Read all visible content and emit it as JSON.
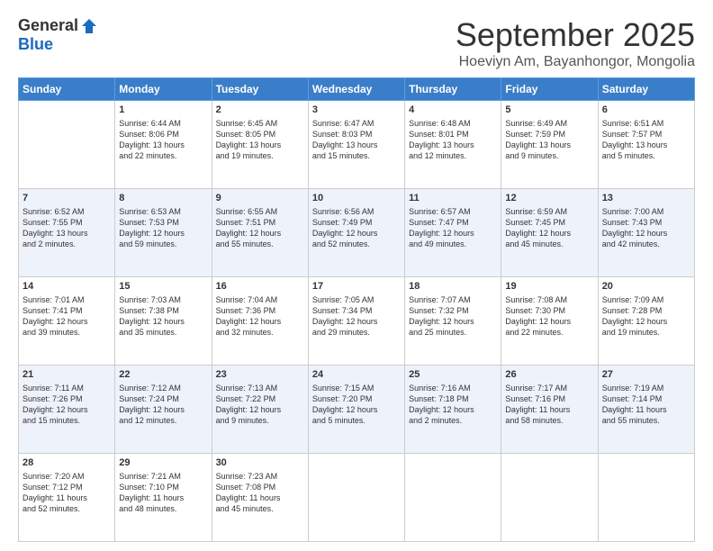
{
  "logo": {
    "general": "General",
    "blue": "Blue"
  },
  "header": {
    "month": "September 2025",
    "location": "Hoeviyn Am, Bayanhongor, Mongolia"
  },
  "days_of_week": [
    "Sunday",
    "Monday",
    "Tuesday",
    "Wednesday",
    "Thursday",
    "Friday",
    "Saturday"
  ],
  "weeks": [
    [
      {
        "day": "",
        "info": ""
      },
      {
        "day": "1",
        "info": "Sunrise: 6:44 AM\nSunset: 8:06 PM\nDaylight: 13 hours\nand 22 minutes."
      },
      {
        "day": "2",
        "info": "Sunrise: 6:45 AM\nSunset: 8:05 PM\nDaylight: 13 hours\nand 19 minutes."
      },
      {
        "day": "3",
        "info": "Sunrise: 6:47 AM\nSunset: 8:03 PM\nDaylight: 13 hours\nand 15 minutes."
      },
      {
        "day": "4",
        "info": "Sunrise: 6:48 AM\nSunset: 8:01 PM\nDaylight: 13 hours\nand 12 minutes."
      },
      {
        "day": "5",
        "info": "Sunrise: 6:49 AM\nSunset: 7:59 PM\nDaylight: 13 hours\nand 9 minutes."
      },
      {
        "day": "6",
        "info": "Sunrise: 6:51 AM\nSunset: 7:57 PM\nDaylight: 13 hours\nand 5 minutes."
      }
    ],
    [
      {
        "day": "7",
        "info": "Sunrise: 6:52 AM\nSunset: 7:55 PM\nDaylight: 13 hours\nand 2 minutes."
      },
      {
        "day": "8",
        "info": "Sunrise: 6:53 AM\nSunset: 7:53 PM\nDaylight: 12 hours\nand 59 minutes."
      },
      {
        "day": "9",
        "info": "Sunrise: 6:55 AM\nSunset: 7:51 PM\nDaylight: 12 hours\nand 55 minutes."
      },
      {
        "day": "10",
        "info": "Sunrise: 6:56 AM\nSunset: 7:49 PM\nDaylight: 12 hours\nand 52 minutes."
      },
      {
        "day": "11",
        "info": "Sunrise: 6:57 AM\nSunset: 7:47 PM\nDaylight: 12 hours\nand 49 minutes."
      },
      {
        "day": "12",
        "info": "Sunrise: 6:59 AM\nSunset: 7:45 PM\nDaylight: 12 hours\nand 45 minutes."
      },
      {
        "day": "13",
        "info": "Sunrise: 7:00 AM\nSunset: 7:43 PM\nDaylight: 12 hours\nand 42 minutes."
      }
    ],
    [
      {
        "day": "14",
        "info": "Sunrise: 7:01 AM\nSunset: 7:41 PM\nDaylight: 12 hours\nand 39 minutes."
      },
      {
        "day": "15",
        "info": "Sunrise: 7:03 AM\nSunset: 7:38 PM\nDaylight: 12 hours\nand 35 minutes."
      },
      {
        "day": "16",
        "info": "Sunrise: 7:04 AM\nSunset: 7:36 PM\nDaylight: 12 hours\nand 32 minutes."
      },
      {
        "day": "17",
        "info": "Sunrise: 7:05 AM\nSunset: 7:34 PM\nDaylight: 12 hours\nand 29 minutes."
      },
      {
        "day": "18",
        "info": "Sunrise: 7:07 AM\nSunset: 7:32 PM\nDaylight: 12 hours\nand 25 minutes."
      },
      {
        "day": "19",
        "info": "Sunrise: 7:08 AM\nSunset: 7:30 PM\nDaylight: 12 hours\nand 22 minutes."
      },
      {
        "day": "20",
        "info": "Sunrise: 7:09 AM\nSunset: 7:28 PM\nDaylight: 12 hours\nand 19 minutes."
      }
    ],
    [
      {
        "day": "21",
        "info": "Sunrise: 7:11 AM\nSunset: 7:26 PM\nDaylight: 12 hours\nand 15 minutes."
      },
      {
        "day": "22",
        "info": "Sunrise: 7:12 AM\nSunset: 7:24 PM\nDaylight: 12 hours\nand 12 minutes."
      },
      {
        "day": "23",
        "info": "Sunrise: 7:13 AM\nSunset: 7:22 PM\nDaylight: 12 hours\nand 9 minutes."
      },
      {
        "day": "24",
        "info": "Sunrise: 7:15 AM\nSunset: 7:20 PM\nDaylight: 12 hours\nand 5 minutes."
      },
      {
        "day": "25",
        "info": "Sunrise: 7:16 AM\nSunset: 7:18 PM\nDaylight: 12 hours\nand 2 minutes."
      },
      {
        "day": "26",
        "info": "Sunrise: 7:17 AM\nSunset: 7:16 PM\nDaylight: 11 hours\nand 58 minutes."
      },
      {
        "day": "27",
        "info": "Sunrise: 7:19 AM\nSunset: 7:14 PM\nDaylight: 11 hours\nand 55 minutes."
      }
    ],
    [
      {
        "day": "28",
        "info": "Sunrise: 7:20 AM\nSunset: 7:12 PM\nDaylight: 11 hours\nand 52 minutes."
      },
      {
        "day": "29",
        "info": "Sunrise: 7:21 AM\nSunset: 7:10 PM\nDaylight: 11 hours\nand 48 minutes."
      },
      {
        "day": "30",
        "info": "Sunrise: 7:23 AM\nSunset: 7:08 PM\nDaylight: 11 hours\nand 45 minutes."
      },
      {
        "day": "",
        "info": ""
      },
      {
        "day": "",
        "info": ""
      },
      {
        "day": "",
        "info": ""
      },
      {
        "day": "",
        "info": ""
      }
    ]
  ]
}
